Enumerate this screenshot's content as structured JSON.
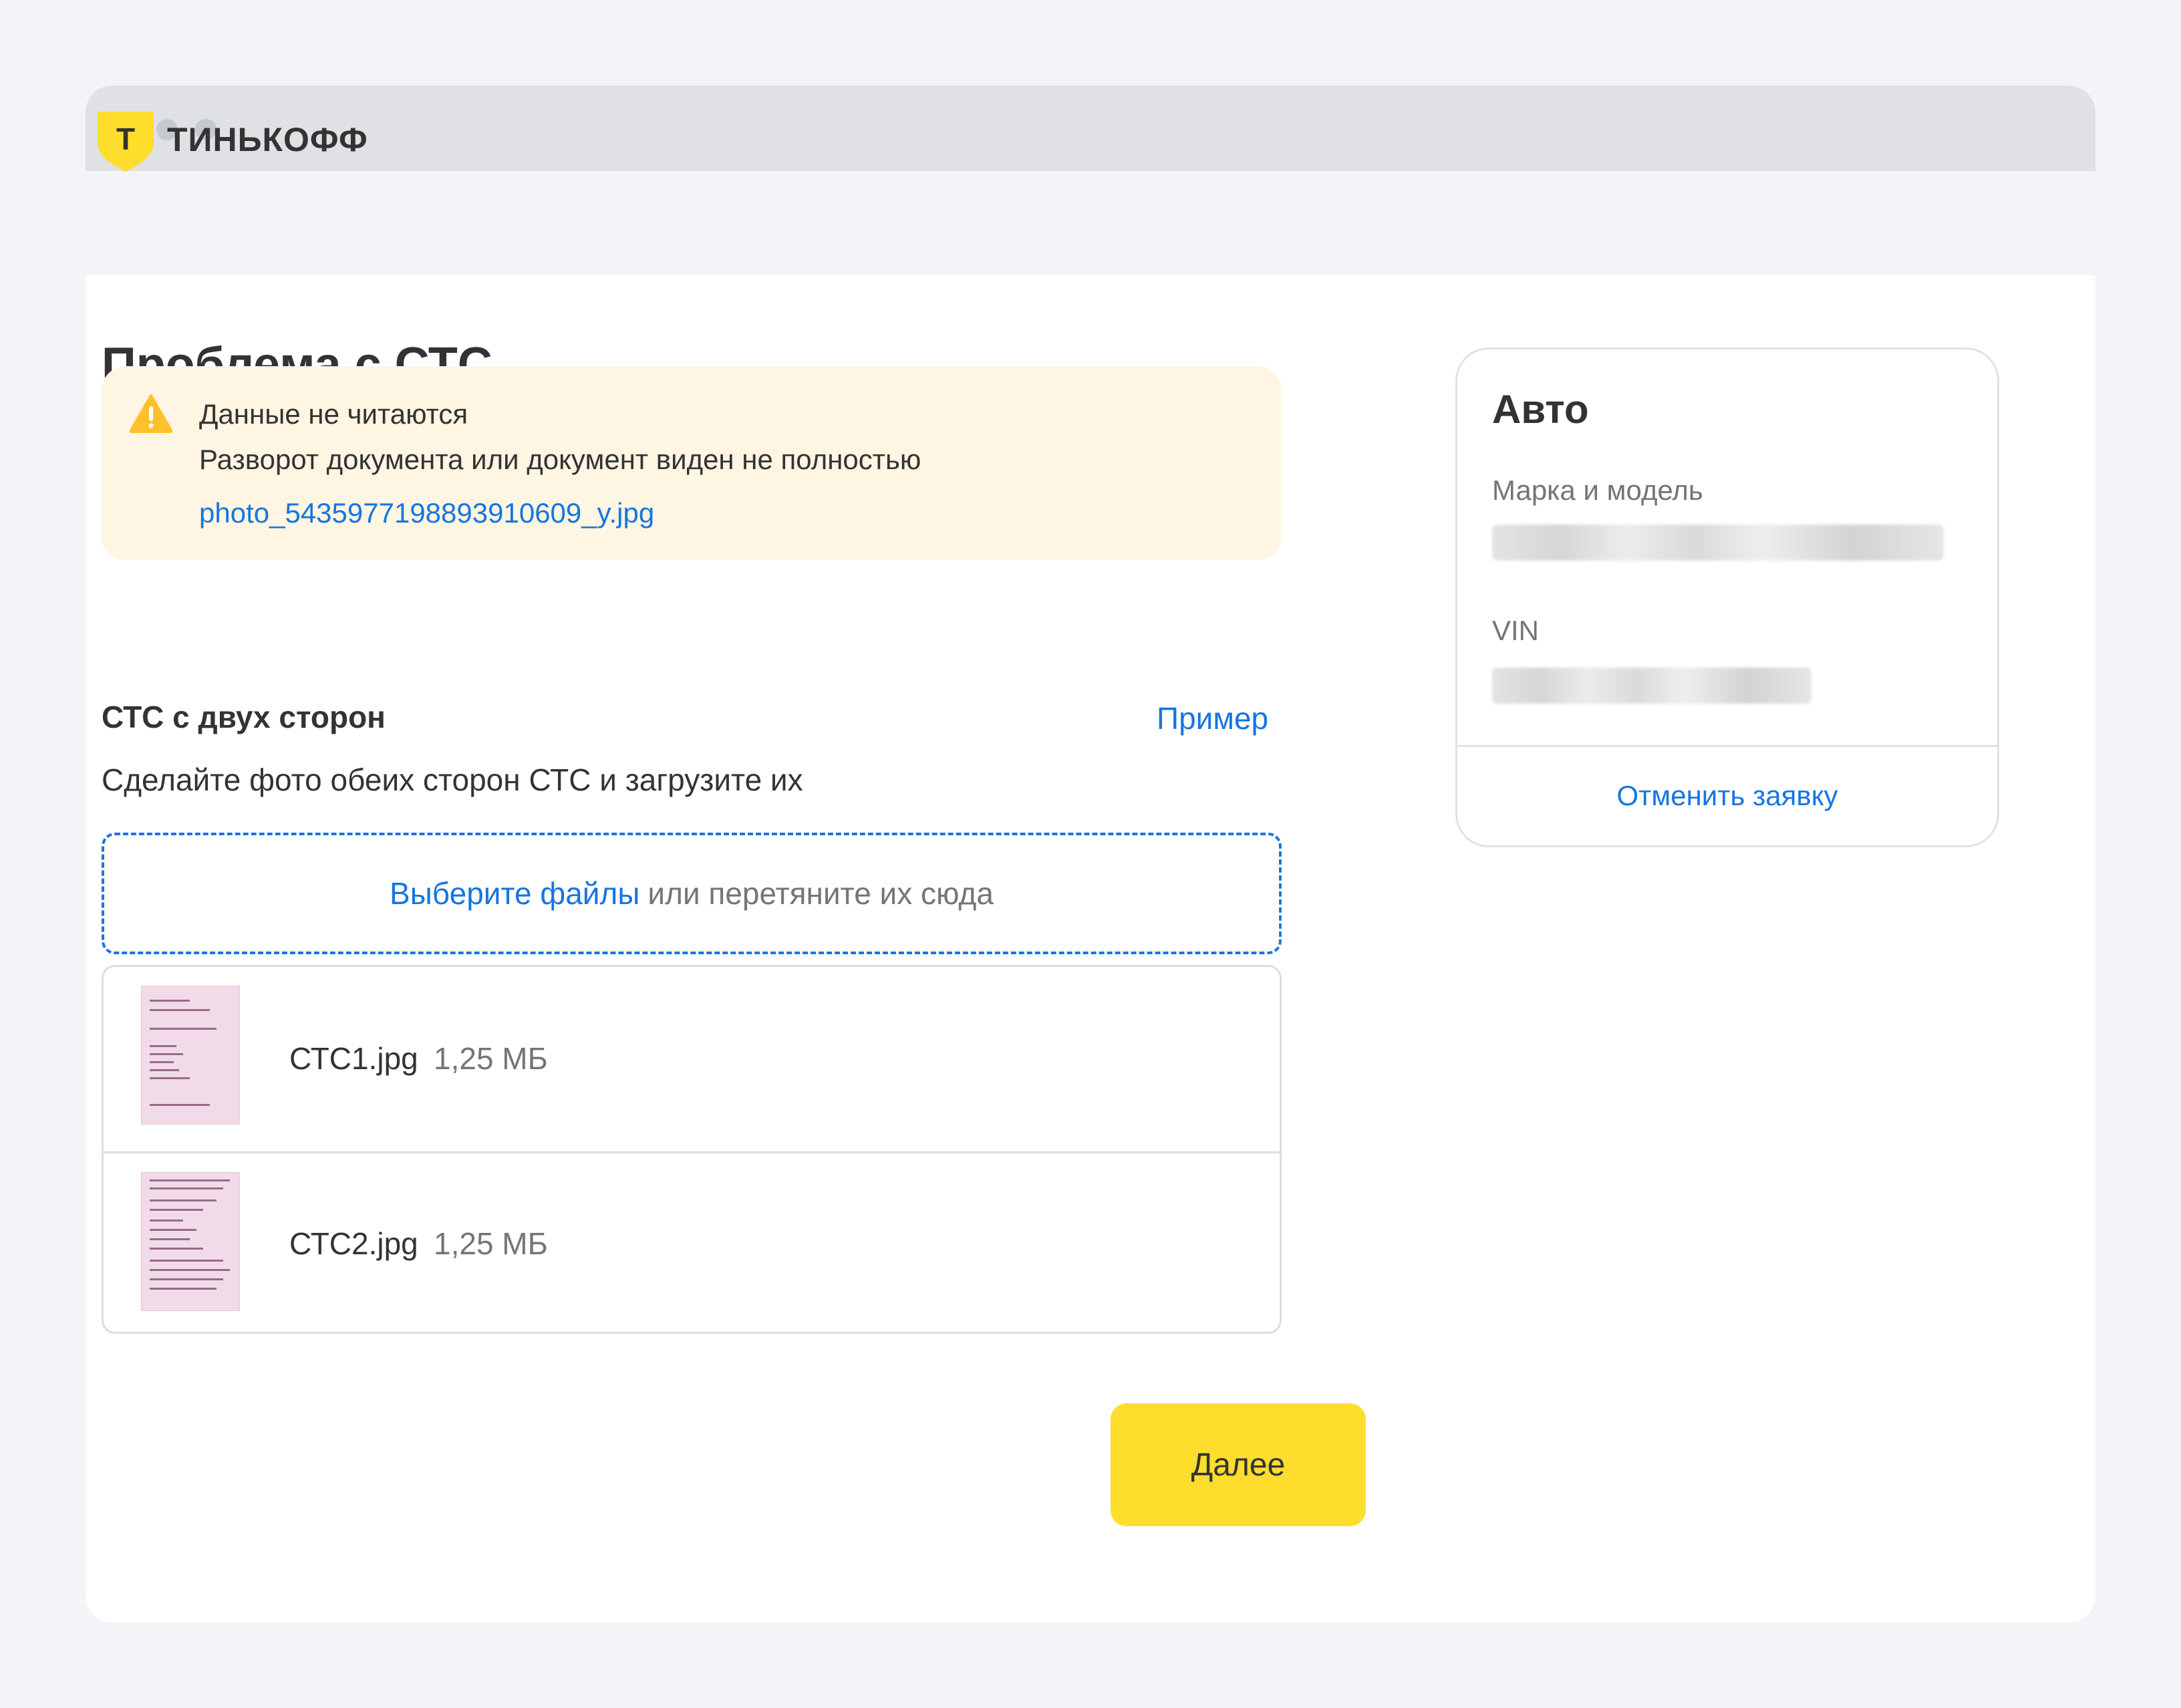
{
  "window": {
    "controls": [
      "window-dot",
      "window-dot",
      "window-dot"
    ]
  },
  "header": {
    "logo_letter": "Т",
    "logo_text": "ТИНЬКОФФ",
    "brand_color": "#ffdd2d"
  },
  "main": {
    "title": "Проблема с СТС",
    "alert": {
      "icon": "warning-icon",
      "heading": "Данные не читаются",
      "text": "Разворот документа или документ виден не полностью",
      "file_link": "photo_5435977198893910609_y.jpg",
      "background": "#fef5e2",
      "icon_color": "#ffc12b"
    },
    "section": {
      "title": "СТС с двух сторон",
      "example_link": "Пример",
      "description": "Сделайте фото обеих сторон СТС и загрузите их"
    },
    "dropzone": {
      "link_text": "Выберите файлы",
      "text": "или перетяните их сюда"
    },
    "files": [
      {
        "name": "СТС1.jpg",
        "size": "1,25 МБ"
      },
      {
        "name": "СТС2.jpg",
        "size": "1,25 МБ"
      }
    ],
    "next_button": "Далее"
  },
  "sidebar": {
    "title": "Авто",
    "fields": [
      {
        "label": "Марка и модель"
      },
      {
        "label": "VIN"
      }
    ],
    "cancel_link": "Отменить заявку"
  },
  "colors": {
    "accent_link": "#1775e0",
    "button": "#ffdd2d",
    "text_primary": "#333333",
    "text_secondary": "#757575"
  }
}
